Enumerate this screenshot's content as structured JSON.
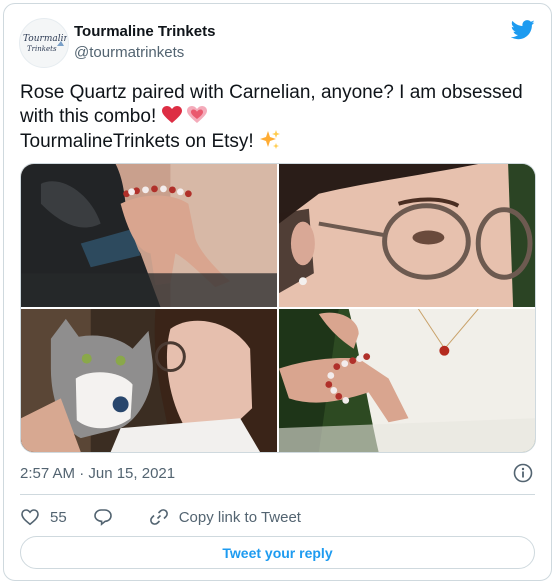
{
  "author": {
    "name": "Tourmaline Trinkets",
    "handle": "@tourmatrinkets",
    "avatar_icon": "tourmaline-trinkets-logo-icon",
    "avatar_logo_text": "Tourmaline Trinkets"
  },
  "tweet": {
    "line1": "Rose Quartz paired with Carnelian, anyone? I am obsessed with this combo!",
    "line2": "TourmalineTrinkets on Etsy!",
    "emojis": [
      "red-heart-icon",
      "sparkling-heart-icon",
      "sparkles-icon"
    ]
  },
  "photos": [
    {
      "icon": "photo-hand-bracelet-dog"
    },
    {
      "icon": "photo-woman-glasses"
    },
    {
      "icon": "photo-cat-woman"
    },
    {
      "icon": "photo-bracelet-white-dress"
    }
  ],
  "meta": {
    "timestamp": "2:57 AM · Jun 15, 2021"
  },
  "actions": {
    "likes": "55",
    "copy_link": "Copy link to Tweet"
  },
  "reply_button": "Tweet your reply",
  "colors": {
    "brand": "#1d9bf0",
    "text": "#0f1419",
    "muted": "#536471",
    "border": "#cfd9de"
  }
}
